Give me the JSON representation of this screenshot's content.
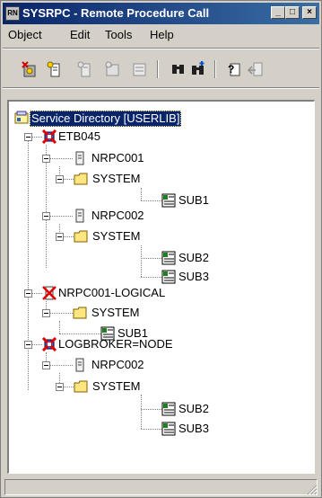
{
  "window": {
    "title": "SYSRPC - Remote Procedure Call",
    "app_icon_text": "RN"
  },
  "titlebar": {
    "minimize": "_",
    "maximize": "□",
    "close": "×"
  },
  "menu": [
    "Object",
    "Edit",
    "Tools",
    "Help"
  ],
  "toolbar": {
    "buttons": [
      "new-server-icon",
      "new-client-icon",
      "new-library-icon",
      "new-folder-icon",
      "properties-icon",
      "find-icon",
      "find-next-icon",
      "help-icon",
      "exit-icon"
    ]
  },
  "tree": {
    "root": "Service Directory [USERLIB]",
    "nodes": {
      "etb045": "ETB045",
      "nrpc001_a": "NRPC001",
      "system_a": "SYSTEM",
      "sub1_a": "SUB1",
      "nrpc002_a": "NRPC002",
      "system_b": "SYSTEM",
      "sub2_b": "SUB2",
      "sub3_b": "SUB3",
      "nrpc001_logical": "NRPC001-LOGICAL",
      "system_c": "SYSTEM",
      "sub1_c": "SUB1",
      "logbroker": "LOGBROKER=NODE",
      "nrpc002_d": "NRPC002",
      "system_d": "SYSTEM",
      "sub2_d": "SUB2",
      "sub3_d": "SUB3"
    }
  },
  "statusbar": {
    "text": ""
  },
  "colors": {
    "title_start": "#0a246a",
    "title_end": "#3a6ea5",
    "face": "#d4d0c8",
    "server_red": "#e00000",
    "folder_yellow": "#ffe680",
    "sub_green": "#208020"
  }
}
